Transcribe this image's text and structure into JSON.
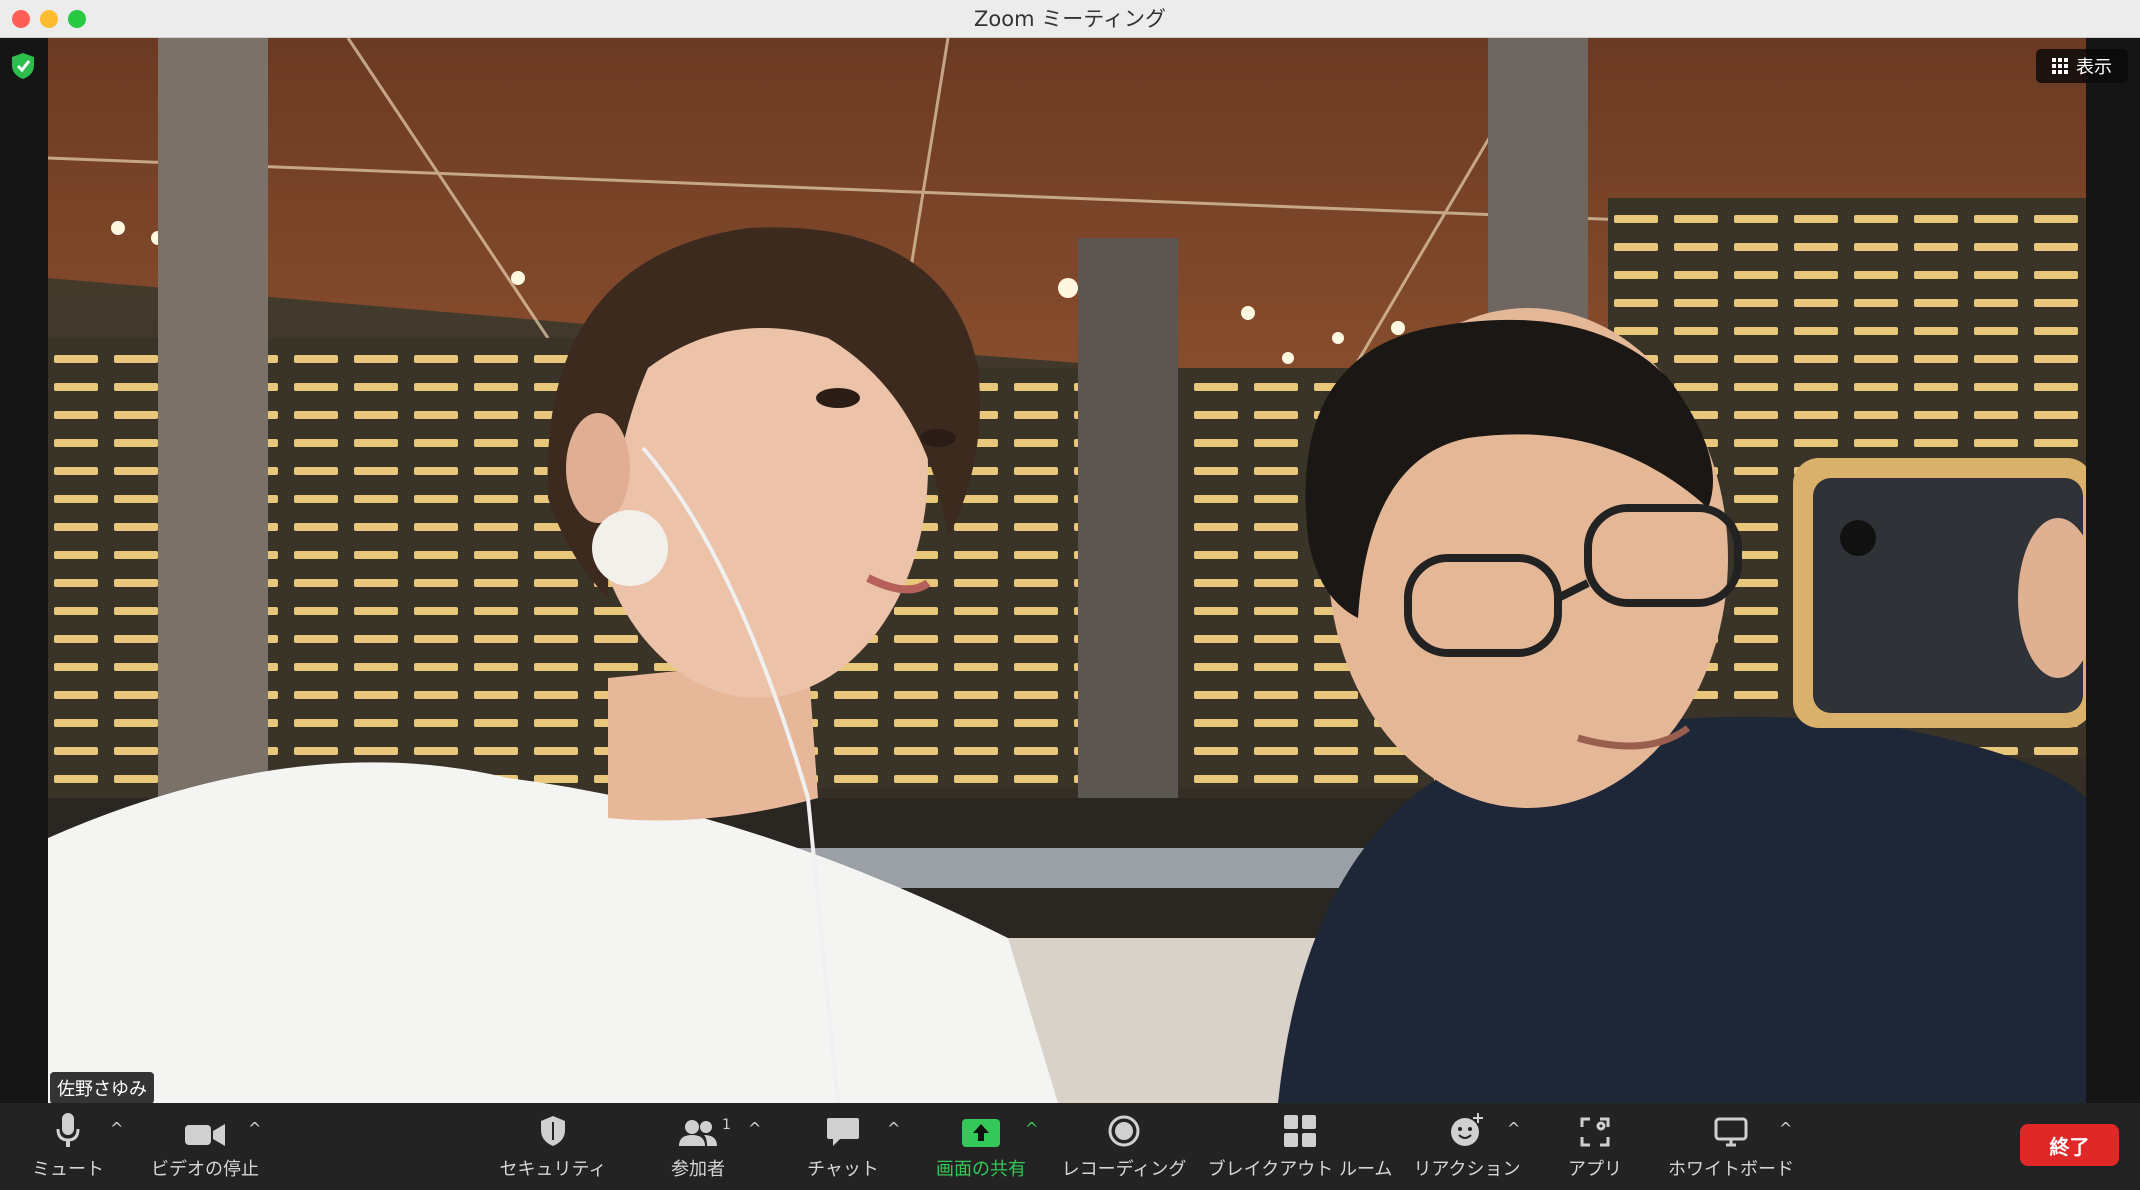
{
  "window": {
    "title": "Zoom ミーティング"
  },
  "meeting": {
    "view_label": "表示",
    "participant_name": "佐野さゆみ"
  },
  "toolbar": {
    "mute_label": "ミュート",
    "video_label": "ビデオの停止",
    "security_label": "セキュリティ",
    "participants_label": "参加者",
    "participants_count": "1",
    "chat_label": "チャット",
    "share_label": "画面の共有",
    "record_label": "レコーディング",
    "breakout_label": "ブレイクアウト ルーム",
    "reactions_label": "リアクション",
    "apps_label": "アプリ",
    "whiteboard_label": "ホワイトボード",
    "end_label": "終了"
  },
  "colors": {
    "share_accent": "#34c759",
    "end_button": "#e02828",
    "toolbar_bg": "#232323",
    "shield": "#2dbd4e"
  }
}
